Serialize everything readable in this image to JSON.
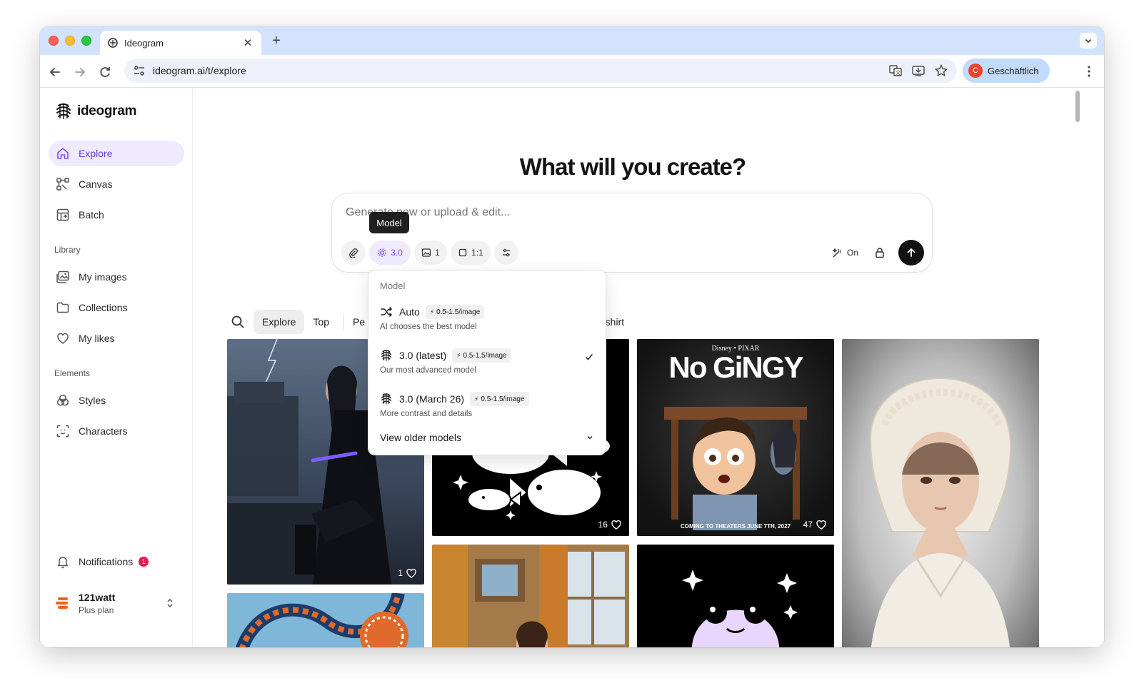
{
  "browser": {
    "tab_title": "Ideogram",
    "url": "ideogram.ai/t/explore",
    "profile_initial": "C",
    "profile_label": "Geschäftlich"
  },
  "sidebar": {
    "brand": "ideogram",
    "nav": [
      {
        "label": "Explore",
        "icon": "home-icon",
        "active": true
      },
      {
        "label": "Canvas",
        "icon": "canvas-icon"
      },
      {
        "label": "Batch",
        "icon": "batch-icon"
      }
    ],
    "library_label": "Library",
    "library": [
      {
        "label": "My images",
        "icon": "images-icon"
      },
      {
        "label": "Collections",
        "icon": "folder-icon"
      },
      {
        "label": "My likes",
        "icon": "heart-icon"
      }
    ],
    "elements_label": "Elements",
    "elements": [
      {
        "label": "Styles",
        "icon": "styles-icon"
      },
      {
        "label": "Characters",
        "icon": "characters-icon"
      }
    ],
    "notifications_label": "Notifications",
    "notifications_count": "1",
    "user": {
      "name": "121watt",
      "plan": "Plus plan"
    }
  },
  "main": {
    "headline": "What will you create?",
    "prompt_placeholder": "Generate new or upload & edit...",
    "toolbar": {
      "model_label": "3.0",
      "image_count": "1",
      "aspect_ratio": "1:1",
      "magic_prompt": "On"
    },
    "tooltip": "Model"
  },
  "model_menu": {
    "title": "Model",
    "options": [
      {
        "name": "Auto",
        "cost": "0.5-1.5/image",
        "desc": "AI chooses the best model",
        "selected": false
      },
      {
        "name": "3.0 (latest)",
        "cost": "0.5-1.5/image",
        "desc": "Our most advanced model",
        "selected": true
      },
      {
        "name": "3.0 (March 26)",
        "cost": "0.5-1.5/image",
        "desc": "More contrast and details",
        "selected": false
      }
    ],
    "older_label": "View older models"
  },
  "filters": {
    "tabs": [
      "Explore",
      "Top",
      "Pe"
    ],
    "trailing": "-shirt"
  },
  "gallery": {
    "cards": [
      {
        "name": "card-cyber-woman",
        "likes": "1"
      },
      {
        "name": "card-fish-coloring",
        "likes": "16"
      },
      {
        "name": "card-no-gingy-poster",
        "likes": "47",
        "poster_brand": "Disney • PIXAR",
        "poster_title": "No GiNGY",
        "poster_tagline": "COMING TO THEATERS JUNE 7TH, 2027"
      },
      {
        "name": "card-lace-bonnet-girl",
        "likes": ""
      }
    ]
  },
  "colors": {
    "accent": "#7c4dff",
    "active_bg": "#efeafe",
    "tab_strip": "#d3e3fd",
    "badge": "#e5194f"
  }
}
